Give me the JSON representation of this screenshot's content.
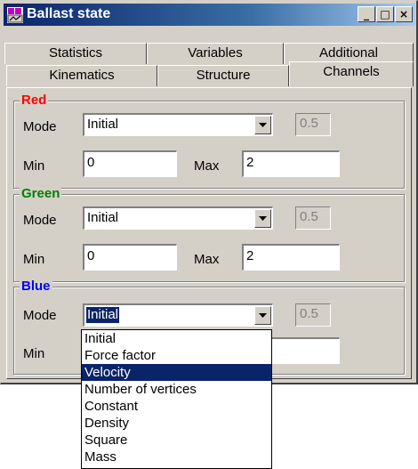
{
  "window": {
    "title": "Ballast state",
    "buttons": {
      "minimize": "_",
      "maximize": "□",
      "close": "×"
    }
  },
  "tabs": {
    "row1": [
      "Statistics",
      "Variables",
      "Additional"
    ],
    "row2": [
      "Kinematics",
      "Structure",
      "Channels"
    ],
    "active": "Channels"
  },
  "labels": {
    "mode": "Mode",
    "min": "Min",
    "max": "Max"
  },
  "channels": [
    {
      "name": "Red",
      "color": "#ff0000",
      "mode": "Initial",
      "value": "0.5",
      "min": "0",
      "max": "2"
    },
    {
      "name": "Green",
      "color": "#008000",
      "mode": "Initial",
      "value": "0.5",
      "min": "0",
      "max": "2"
    },
    {
      "name": "Blue",
      "color": "#0000ff",
      "mode": "Initial",
      "value": "0.5",
      "min": "",
      "max": ""
    }
  ],
  "dropdown": {
    "options": [
      "Initial",
      "Force factor",
      "Velocity",
      "Number of vertices",
      "Constant",
      "Density",
      "Square",
      "Mass"
    ],
    "highlighted": "Velocity"
  },
  "colors": {
    "titlebar": "#0a246a",
    "face": "#d4d0c8",
    "selection": "#0a246a"
  }
}
